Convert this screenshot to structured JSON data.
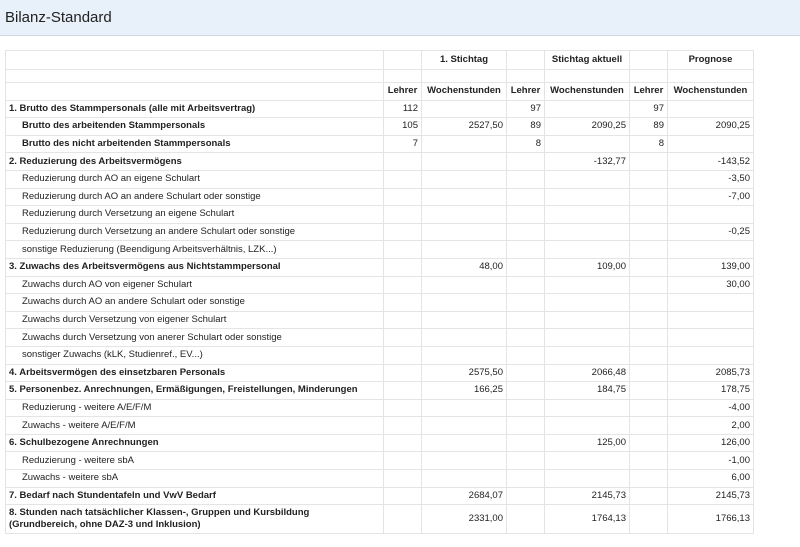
{
  "window": {
    "title": "Bilanz-Standard"
  },
  "table": {
    "group_headers": [
      "1. Stichtag",
      "Stichtag aktuell",
      "Prognose"
    ],
    "column_headers": [
      "Lehrer",
      "Wochenstunden",
      "Lehrer",
      "Wochenstunden",
      "Lehrer",
      "Wochenstunden"
    ],
    "rows": [
      {
        "label": "1. Brutto des Stammpersonals (alle mit Arbeitsvertrag)",
        "bold": true,
        "indent": false,
        "v": [
          "112",
          "",
          "97",
          "",
          "97",
          ""
        ]
      },
      {
        "label": "Brutto des arbeitenden Stammpersonals",
        "bold": true,
        "indent": true,
        "v": [
          "105",
          "2527,50",
          "89",
          "2090,25",
          "89",
          "2090,25"
        ]
      },
      {
        "label": "Brutto des nicht arbeitenden Stammpersonals",
        "bold": true,
        "indent": true,
        "v": [
          "7",
          "",
          "8",
          "",
          "8",
          ""
        ]
      },
      {
        "label": "2. Reduzierung des Arbeitsvermögens",
        "bold": true,
        "indent": false,
        "v": [
          "",
          "",
          "",
          "-132,77",
          "",
          "-143,52"
        ]
      },
      {
        "label": "Reduzierung durch AO an eigene Schulart",
        "bold": false,
        "indent": true,
        "v": [
          "",
          "",
          "",
          "",
          "",
          "-3,50"
        ]
      },
      {
        "label": "Reduzierung durch AO an andere Schulart oder sonstige",
        "bold": false,
        "indent": true,
        "v": [
          "",
          "",
          "",
          "",
          "",
          "-7,00"
        ]
      },
      {
        "label": "Reduzierung durch Versetzung an eigene Schulart",
        "bold": false,
        "indent": true,
        "v": [
          "",
          "",
          "",
          "",
          "",
          ""
        ]
      },
      {
        "label": "Reduzierung durch Versetzung an andere Schulart oder sonstige",
        "bold": false,
        "indent": true,
        "v": [
          "",
          "",
          "",
          "",
          "",
          "-0,25"
        ]
      },
      {
        "label": "sonstige Reduzierung (Beendigung Arbeitsverhältnis, LZK...)",
        "bold": false,
        "indent": true,
        "v": [
          "",
          "",
          "",
          "",
          "",
          ""
        ]
      },
      {
        "label": "3. Zuwachs des Arbeitsvermögens aus Nichtstammpersonal",
        "bold": true,
        "indent": false,
        "v": [
          "",
          "48,00",
          "",
          "109,00",
          "",
          "139,00"
        ]
      },
      {
        "label": "Zuwachs durch AO von eigener Schulart",
        "bold": false,
        "indent": true,
        "v": [
          "",
          "",
          "",
          "",
          "",
          "30,00"
        ]
      },
      {
        "label": "Zuwachs durch AO an andere Schulart oder sonstige",
        "bold": false,
        "indent": true,
        "v": [
          "",
          "",
          "",
          "",
          "",
          ""
        ]
      },
      {
        "label": "Zuwachs durch Versetzung von eigener Schulart",
        "bold": false,
        "indent": true,
        "v": [
          "",
          "",
          "",
          "",
          "",
          ""
        ]
      },
      {
        "label": "Zuwachs durch Versetzung von anerer Schulart oder sonstige",
        "bold": false,
        "indent": true,
        "v": [
          "",
          "",
          "",
          "",
          "",
          ""
        ]
      },
      {
        "label": "sonstiger Zuwachs (kLK, Studienref., EV...)",
        "bold": false,
        "indent": true,
        "v": [
          "",
          "",
          "",
          "",
          "",
          ""
        ]
      },
      {
        "label": "4. Arbeitsvermögen des einsetzbaren Personals",
        "bold": true,
        "indent": false,
        "v": [
          "",
          "2575,50",
          "",
          "2066,48",
          "",
          "2085,73"
        ]
      },
      {
        "label": "5. Personenbez. Anrechnungen, Ermäßigungen, Freistellungen, Minderungen",
        "bold": true,
        "indent": false,
        "v": [
          "",
          "166,25",
          "",
          "184,75",
          "",
          "178,75"
        ]
      },
      {
        "label": "Reduzierung - weitere A/E/F/M",
        "bold": false,
        "indent": true,
        "v": [
          "",
          "",
          "",
          "",
          "",
          "-4,00"
        ]
      },
      {
        "label": "Zuwachs - weitere A/E/F/M",
        "bold": false,
        "indent": true,
        "v": [
          "",
          "",
          "",
          "",
          "",
          "2,00"
        ]
      },
      {
        "label": "6. Schulbezogene Anrechnungen",
        "bold": true,
        "indent": false,
        "v": [
          "",
          "",
          "",
          "125,00",
          "",
          "126,00"
        ]
      },
      {
        "label": "Reduzierung - weitere sbA",
        "bold": false,
        "indent": true,
        "v": [
          "",
          "",
          "",
          "",
          "",
          "-1,00"
        ]
      },
      {
        "label": "Zuwachs - weitere sbA",
        "bold": false,
        "indent": true,
        "v": [
          "",
          "",
          "",
          "",
          "",
          "6,00"
        ]
      },
      {
        "label": "7. Bedarf nach Stundentafeln und VwV Bedarf",
        "bold": true,
        "indent": false,
        "v": [
          "",
          "2684,07",
          "",
          "2145,73",
          "",
          "2145,73"
        ]
      },
      {
        "label": "8. Stunden nach tatsächlicher Klassen-, Gruppen und Kursbildung (Grundbereich, ohne DAZ-3 und Inklusion)",
        "bold": true,
        "indent": false,
        "tall": true,
        "v": [
          "",
          "2331,00",
          "",
          "1764,13",
          "",
          "1766,13"
        ]
      }
    ]
  }
}
